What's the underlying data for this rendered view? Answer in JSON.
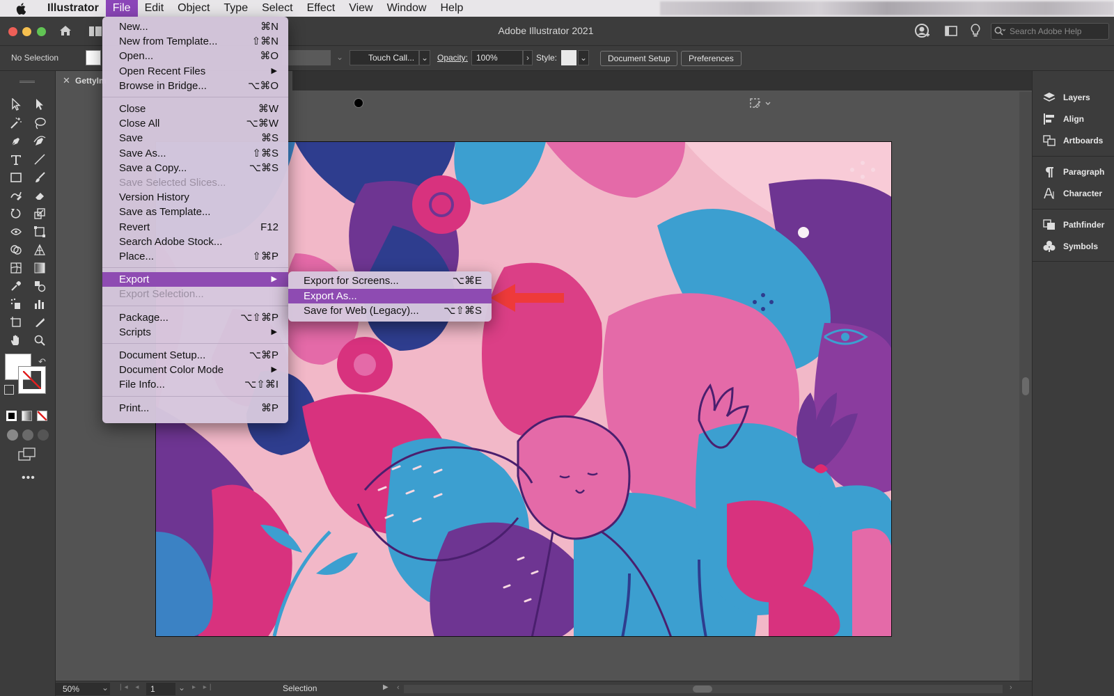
{
  "menubar": {
    "app": "Illustrator",
    "items": [
      "File",
      "Edit",
      "Object",
      "Type",
      "Select",
      "Effect",
      "View",
      "Window",
      "Help"
    ],
    "active": "File"
  },
  "titlebar": {
    "title": "Adobe Illustrator 2021",
    "search_placeholder": "Search Adobe Help"
  },
  "controlbar": {
    "selection": "No Selection",
    "brush": "Touch Call...",
    "opacity_label": "Opacity:",
    "opacity_value": "100%",
    "style_label": "Style:",
    "document_setup": "Document Setup",
    "preferences": "Preferences"
  },
  "tab": {
    "name": "GettyIm"
  },
  "file_menu": {
    "groups": [
      [
        {
          "label": "New...",
          "shortcut": "⌘N"
        },
        {
          "label": "New from Template...",
          "shortcut": "⇧⌘N"
        },
        {
          "label": "Open...",
          "shortcut": "⌘O"
        },
        {
          "label": "Open Recent Files",
          "shortcut": "",
          "submenu": true
        },
        {
          "label": "Browse in Bridge...",
          "shortcut": "⌥⌘O"
        }
      ],
      [
        {
          "label": "Close",
          "shortcut": "⌘W"
        },
        {
          "label": "Close All",
          "shortcut": "⌥⌘W"
        },
        {
          "label": "Save",
          "shortcut": "⌘S"
        },
        {
          "label": "Save As...",
          "shortcut": "⇧⌘S"
        },
        {
          "label": "Save a Copy...",
          "shortcut": "⌥⌘S"
        },
        {
          "label": "Save Selected Slices...",
          "shortcut": "",
          "disabled": true
        },
        {
          "label": "Version History",
          "shortcut": ""
        },
        {
          "label": "Save as Template...",
          "shortcut": ""
        },
        {
          "label": "Revert",
          "shortcut": "F12"
        },
        {
          "label": "Search Adobe Stock...",
          "shortcut": ""
        },
        {
          "label": "Place...",
          "shortcut": "⇧⌘P"
        }
      ],
      [
        {
          "label": "Export",
          "shortcut": "",
          "submenu": true,
          "highlighted": true
        },
        {
          "label": "Export Selection...",
          "shortcut": "",
          "disabled": true
        }
      ],
      [
        {
          "label": "Package...",
          "shortcut": "⌥⇧⌘P"
        },
        {
          "label": "Scripts",
          "shortcut": "",
          "submenu": true
        }
      ],
      [
        {
          "label": "Document Setup...",
          "shortcut": "⌥⌘P"
        },
        {
          "label": "Document Color Mode",
          "shortcut": "",
          "submenu": true
        },
        {
          "label": "File Info...",
          "shortcut": "⌥⇧⌘I"
        }
      ],
      [
        {
          "label": "Print...",
          "shortcut": "⌘P"
        }
      ]
    ]
  },
  "export_submenu": {
    "items": [
      {
        "label": "Export for Screens...",
        "shortcut": "⌥⌘E"
      },
      {
        "label": "Export As...",
        "shortcut": "",
        "highlighted": true
      },
      {
        "label": "Save for Web (Legacy)...",
        "shortcut": "⌥⇧⌘S"
      }
    ]
  },
  "panels": {
    "items": [
      "Layers",
      "Align",
      "Artboards",
      "Paragraph",
      "Character",
      "Pathfinder",
      "Symbols"
    ]
  },
  "statusbar": {
    "zoom": "50%",
    "artboard": "1",
    "tool": "Selection"
  },
  "colors": {
    "accent": "#8e4bb2",
    "menu_bg": "#d6c7dd",
    "arrow": "#ee3a3a",
    "art_pink": "#f2b8c8",
    "art_magenta": "#d8327e",
    "art_blue": "#3c9fd0",
    "art_purple": "#6e3592",
    "art_navy": "#2e3d8e"
  }
}
